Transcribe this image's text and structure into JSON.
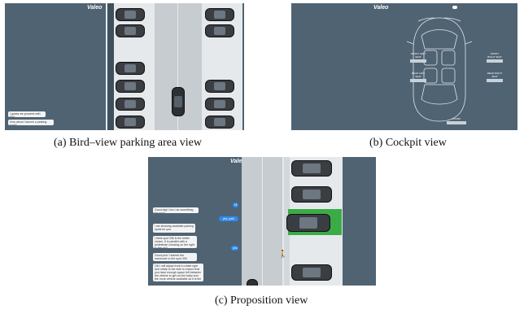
{
  "captions": {
    "a": "(a) Bird–view parking area view",
    "b": "(b) Cockpit view",
    "c": "(c) Proposition view"
  },
  "logo": "Valeo",
  "panel_a": {
    "messages": [
      "I guess we proceed with that",
      "How about I launch a parking spot?"
    ]
  },
  "panel_b": {
    "seats": [
      {
        "label": "FRONT LEFT SEAT"
      },
      {
        "label": "FRONT RIGHT SEAT"
      },
      {
        "label": "REAR LEFT SEAT"
      },
      {
        "label": "REAR RIGHT SEAT"
      },
      {
        "label": "TRUNK"
      }
    ]
  },
  "panel_c": {
    "messages": [
      {
        "side": "left",
        "text": "Good day! Can I do something for you?"
      },
      {
        "side": "right",
        "text": "Hi"
      },
      {
        "side": "right",
        "text": "yes, park here"
      },
      {
        "side": "left",
        "text": "I am showing available parking spots for you."
      },
      {
        "side": "left",
        "text": "I think spot 336 is the better choice. It is parallel with a pedestrian crossing on the right. Is this ok?"
      },
      {
        "side": "right",
        "text": "yes"
      },
      {
        "side": "left",
        "text": "Good pick! I started the maneuver to the spot 330."
      },
      {
        "side": "left",
        "text": "Ok! I will adjust front to rotate right and rotate to the side to ensure that you have enough space left between the vehicle to get out the baby and the more vehicle available as it is the front left."
      }
    ]
  }
}
